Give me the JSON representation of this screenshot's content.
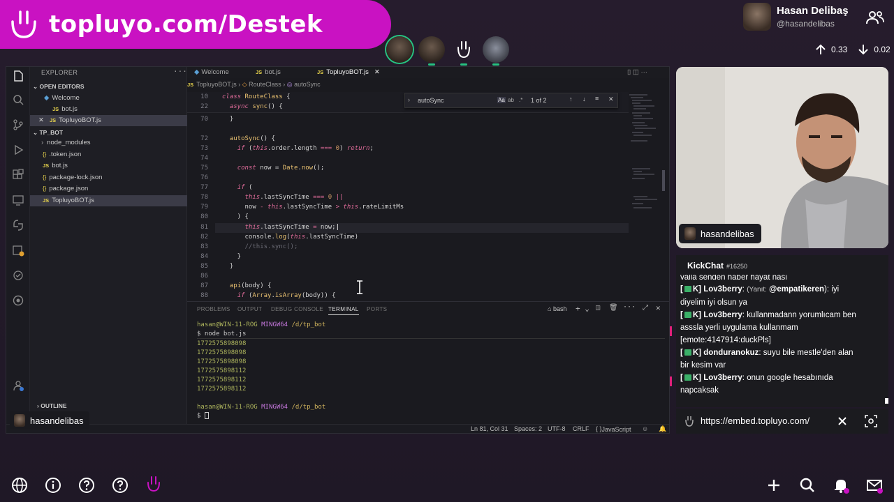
{
  "banner": {
    "text": "topluyo.com/Destek"
  },
  "user": {
    "name": "Hasan Delibaş",
    "handle": "@hasandelibas"
  },
  "stats": {
    "up": "0.33",
    "down": "0.02"
  },
  "vscode": {
    "explorer_title": "EXPLORER",
    "open_editors_label": "OPEN EDITORS",
    "open_editors": [
      "Welcome",
      "bot.js",
      "TopluyoBOT.js"
    ],
    "folder_label": "TP_BOT",
    "files": [
      "node_modules",
      ".token.json",
      "bot.js",
      "package-lock.json",
      "package.json",
      "TopluyoBOT.js"
    ],
    "outline_label": "OUTLINE",
    "tabs": [
      "Welcome",
      "bot.js",
      "TopluyoBOT.js"
    ],
    "breadcrumb": [
      "TopluyoBOT.js",
      "RouteClass",
      "autoSync"
    ],
    "find": {
      "query": "autoSync",
      "count": "1 of 2",
      "opt_case": "Aa",
      "opt_word": "ab",
      "opt_regex": ".*"
    },
    "panel_tabs": [
      "PROBLEMS",
      "OUTPUT",
      "DEBUG CONSOLE",
      "TERMINAL",
      "PORTS"
    ],
    "shell_label": "bash",
    "terminal": {
      "prompt1": "hasan@WIN-11-ROG",
      "env1": "MINGW64",
      "path1": "/d/tp_bot",
      "cmd": "$ node bot.js",
      "outputs": [
        "1772575898098",
        "1772575898098",
        "1772575898098",
        "1772575898112",
        "1772575898112",
        "1772575898112"
      ],
      "prompt2": "hasan@WIN-11-ROG",
      "env2": "MINGW64",
      "path2": "/d/tp_bot",
      "cursor": "$"
    },
    "status": {
      "position": "Ln 81, Col 31",
      "spaces": "Spaces: 2",
      "encoding": "UTF-8",
      "eol": "CRLF",
      "language": "JavaScript"
    }
  },
  "cam_user": "hasandelibas",
  "screen_user": "hasandelibas",
  "chat": {
    "title": "KickChat",
    "id": "#16250",
    "partial_line": "valla senden haber hayat nasi",
    "messages": [
      {
        "user": "Lov3berry",
        "reply_label": "(Yanıt:",
        "reply_to": "@empatikeren",
        "lines": [
          "): iyi",
          "diyelim iyi olsun ya"
        ]
      },
      {
        "user": "Lov3berry",
        "lines": [
          "kullanmadann yorumlıcam ben",
          "asssla yerli uygulama kullanmam",
          "[emote:4147914:duckPls]"
        ]
      },
      {
        "user": "donduranokuz",
        "lines": [
          "suyu bile mestle'den alan",
          "bir kesim var"
        ]
      },
      {
        "user": "Lov3berry",
        "lines": [
          "onun google hesabınıda",
          "napcaksak"
        ]
      }
    ],
    "badge_prefix": "[",
    "badge_suffix": "K]",
    "url": "https://embed.topluyo.com/"
  },
  "colors": {
    "banner": "#c912c2",
    "accent_green": "#26c281",
    "chat_pink": "#e0207a"
  }
}
